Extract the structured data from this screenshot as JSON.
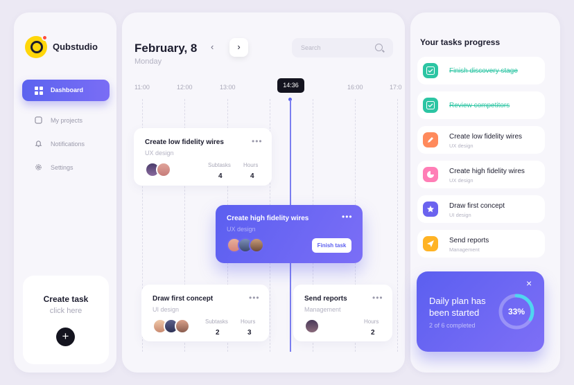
{
  "brand": {
    "name": "Qubstudio"
  },
  "sidebar": {
    "items": [
      {
        "label": "Dashboard",
        "icon": "grid-icon",
        "active": true
      },
      {
        "label": "My projects",
        "icon": "folder-icon"
      },
      {
        "label": "Notifications",
        "icon": "bell-icon"
      },
      {
        "label": "Settings",
        "icon": "gear-icon"
      }
    ],
    "create": {
      "title": "Create task",
      "subtitle": "click here",
      "button": "+"
    }
  },
  "header": {
    "date": "February, 8",
    "weekday": "Monday",
    "prev": "‹",
    "next": "›",
    "search_placeholder": "Search"
  },
  "timeline": {
    "times": [
      "11:00",
      "12:00",
      "13:00",
      "16:00",
      "17:0"
    ],
    "now": "14:36"
  },
  "tasks": [
    {
      "title": "Create low fidelity wires",
      "category": "UX design",
      "subtasks_label": "Subtasks",
      "subtasks": "4",
      "hours_label": "Hours",
      "hours": "4"
    },
    {
      "title": "Create high fidelity wires",
      "category": "UX design",
      "action": "Finish task"
    },
    {
      "title": "Draw first concept",
      "category": "UI design",
      "subtasks_label": "Subtasks",
      "subtasks": "2",
      "hours_label": "Hours",
      "hours": "3"
    },
    {
      "title": "Send reports",
      "category": "Management",
      "hours_label": "Hours",
      "hours": "2"
    }
  ],
  "progress": {
    "title": "Your tasks progress",
    "items": [
      {
        "title": "Finish discovery stage",
        "done": true,
        "color": "#2cc5a3"
      },
      {
        "title": "Review competitors",
        "done": true,
        "color": "#2cc5a3"
      },
      {
        "title": "Create low fidelity wires",
        "category": "UX design",
        "color": "#ff8a5c"
      },
      {
        "title": "Create high fidelity wires",
        "category": "UX design",
        "color": "#ff7eb6"
      },
      {
        "title": "Draw first concept",
        "category": "UI design",
        "color": "#6b63ef"
      },
      {
        "title": "Send reports",
        "category": "Management",
        "color": "#ffb324"
      }
    ]
  },
  "plan": {
    "title": "Daily plan has been started",
    "completed": "2 of 6 completed",
    "percent_label": "33%",
    "percent": 33,
    "close": "×"
  },
  "colors": {
    "accent": "#5b63ef",
    "done": "#2cc5a3",
    "dark": "#14141f"
  }
}
